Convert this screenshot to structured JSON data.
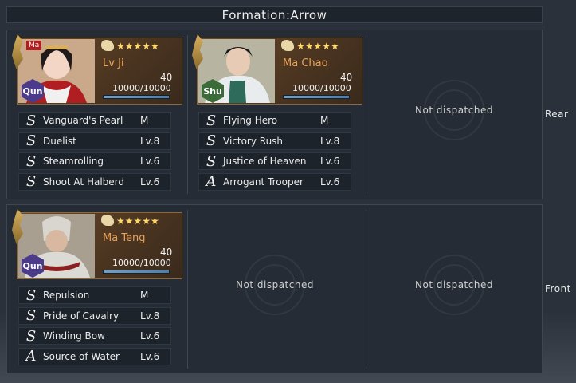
{
  "title": "Formation:Arrow",
  "rows": {
    "rear": {
      "label": "Rear"
    },
    "front": {
      "label": "Front"
    }
  },
  "empty_text": "Not dispatched",
  "heroes": [
    {
      "name": "Lv Ji",
      "badge": "Ma",
      "faction": "Qun",
      "stars": "★★★★★",
      "level": "40",
      "troops": "10000/10000",
      "troop_fraction": 1.0,
      "skills": [
        {
          "grade": "S",
          "name": "Vanguard's Pearl",
          "level": "M"
        },
        {
          "grade": "S",
          "name": "Duelist",
          "level": "Lv.8"
        },
        {
          "grade": "S",
          "name": "Steamrolling",
          "level": "Lv.6"
        },
        {
          "grade": "S",
          "name": "Shoot At Halberd",
          "level": "Lv.6"
        }
      ]
    },
    {
      "name": "Ma Chao",
      "faction": "Shu",
      "stars": "★★★★★",
      "level": "40",
      "troops": "10000/10000",
      "troop_fraction": 1.0,
      "skills": [
        {
          "grade": "S",
          "name": "Flying Hero",
          "level": "M"
        },
        {
          "grade": "S",
          "name": "Victory Rush",
          "level": "Lv.8"
        },
        {
          "grade": "S",
          "name": "Justice of Heaven",
          "level": "Lv.6"
        },
        {
          "grade": "A",
          "name": "Arrogant Trooper",
          "level": "Lv.6"
        }
      ]
    },
    {
      "name": "Ma Teng",
      "faction": "Qun",
      "stars": "★★★★★",
      "level": "40",
      "troops": "10000/10000",
      "troop_fraction": 1.0,
      "skills": [
        {
          "grade": "S",
          "name": "Repulsion",
          "level": "M"
        },
        {
          "grade": "S",
          "name": "Pride of Cavalry",
          "level": "Lv.8"
        },
        {
          "grade": "S",
          "name": "Winding Bow",
          "level": "Lv.6"
        },
        {
          "grade": "A",
          "name": "Source of Water",
          "level": "Lv.6"
        }
      ]
    }
  ],
  "colors": {
    "name": "#e7a35a",
    "star": "#ffd86a",
    "qun": "#4c3a8a",
    "shu": "#3c6b3a"
  }
}
